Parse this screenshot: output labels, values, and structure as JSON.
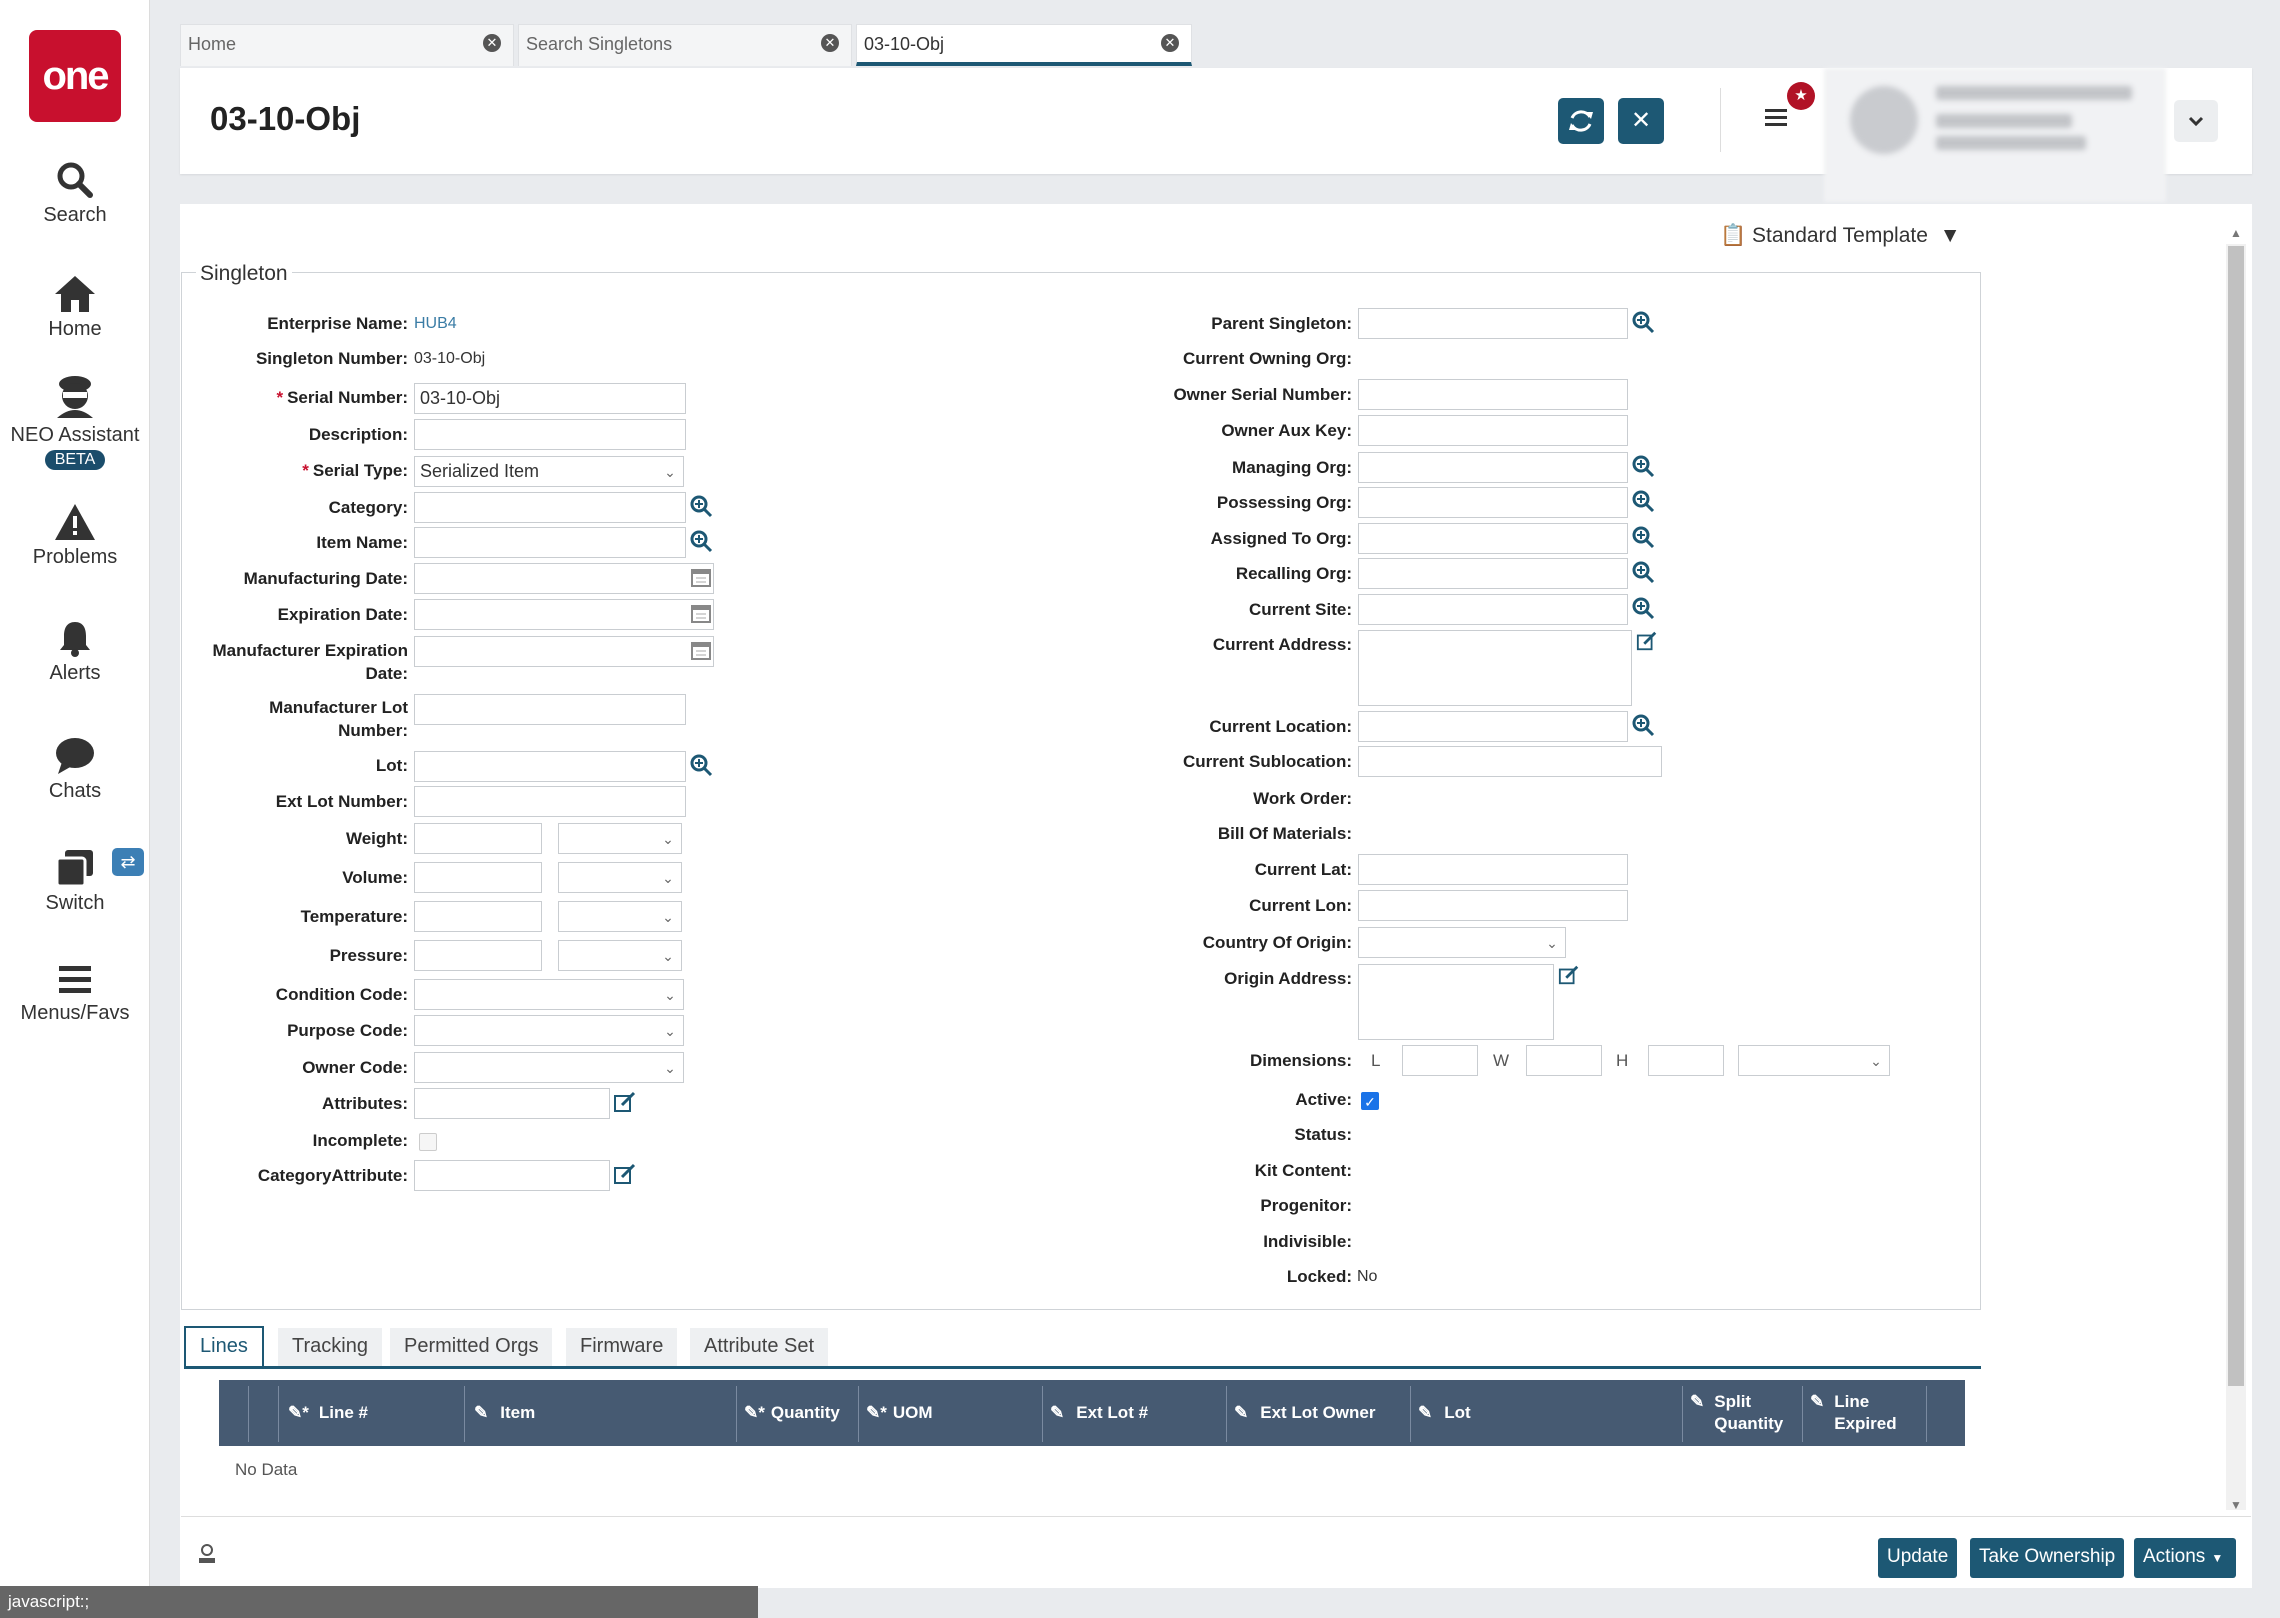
{
  "sidebar": {
    "logo": "one",
    "items": [
      {
        "label": "Search"
      },
      {
        "label": "Home"
      },
      {
        "label": "NEO Assistant",
        "badge": "BETA"
      },
      {
        "label": "Problems"
      },
      {
        "label": "Alerts"
      },
      {
        "label": "Chats"
      },
      {
        "label": "Switch"
      },
      {
        "label": "Menus/Favs"
      }
    ]
  },
  "tabs": [
    {
      "label": "Home"
    },
    {
      "label": "Search Singletons"
    },
    {
      "label": "03-10-Obj"
    }
  ],
  "header": {
    "title": "03-10-Obj"
  },
  "template": {
    "label": "Standard Template"
  },
  "section": {
    "title": "Singleton"
  },
  "left": {
    "enterprise_name": {
      "label": "Enterprise Name:",
      "value": "HUB4"
    },
    "singleton_number": {
      "label": "Singleton Number:",
      "value": "03-10-Obj"
    },
    "serial_number": {
      "label": "Serial Number:",
      "value": "03-10-Obj"
    },
    "description": {
      "label": "Description:"
    },
    "serial_type": {
      "label": "Serial Type:",
      "value": "Serialized Item"
    },
    "category": {
      "label": "Category:"
    },
    "item_name": {
      "label": "Item Name:"
    },
    "manufacturing_date": {
      "label": "Manufacturing Date:"
    },
    "expiration_date": {
      "label": "Expiration Date:"
    },
    "manufacturer_expiration_date": {
      "label1": "Manufacturer Expiration",
      "label2": "Date:"
    },
    "manufacturer_lot_number": {
      "label1": "Manufacturer Lot",
      "label2": "Number:"
    },
    "lot": {
      "label": "Lot:"
    },
    "ext_lot_number": {
      "label": "Ext Lot Number:"
    },
    "weight": {
      "label": "Weight:"
    },
    "volume": {
      "label": "Volume:"
    },
    "temperature": {
      "label": "Temperature:"
    },
    "pressure": {
      "label": "Pressure:"
    },
    "condition_code": {
      "label": "Condition Code:"
    },
    "purpose_code": {
      "label": "Purpose Code:"
    },
    "owner_code": {
      "label": "Owner Code:"
    },
    "attributes": {
      "label": "Attributes:"
    },
    "incomplete": {
      "label": "Incomplete:",
      "checked": false
    },
    "category_attribute": {
      "label": "CategoryAttribute:"
    }
  },
  "right": {
    "parent_singleton": {
      "label": "Parent Singleton:"
    },
    "current_owning_org": {
      "label": "Current Owning Org:"
    },
    "owner_serial_number": {
      "label": "Owner Serial Number:"
    },
    "owner_aux_key": {
      "label": "Owner Aux Key:"
    },
    "managing_org": {
      "label": "Managing Org:"
    },
    "possessing_org": {
      "label": "Possessing Org:"
    },
    "assigned_to_org": {
      "label": "Assigned To Org:"
    },
    "recalling_org": {
      "label": "Recalling Org:"
    },
    "current_site": {
      "label": "Current Site:"
    },
    "current_address": {
      "label": "Current Address:"
    },
    "current_location": {
      "label": "Current Location:"
    },
    "current_sublocation": {
      "label": "Current Sublocation:"
    },
    "work_order": {
      "label": "Work Order:"
    },
    "bill_of_materials": {
      "label": "Bill Of Materials:"
    },
    "current_lat": {
      "label": "Current Lat:"
    },
    "current_lon": {
      "label": "Current Lon:"
    },
    "country_of_origin": {
      "label": "Country Of Origin:"
    },
    "origin_address": {
      "label": "Origin Address:"
    },
    "dimensions": {
      "label": "Dimensions:",
      "l": "L",
      "w": "W",
      "h": "H"
    },
    "active": {
      "label": "Active:",
      "checked": true
    },
    "status": {
      "label": "Status:"
    },
    "kit_content": {
      "label": "Kit Content:"
    },
    "progenitor": {
      "label": "Progenitor:"
    },
    "indivisible": {
      "label": "Indivisible:"
    },
    "locked": {
      "label": "Locked:",
      "value": "No"
    }
  },
  "bottom_tabs": [
    {
      "label": "Lines"
    },
    {
      "label": "Tracking"
    },
    {
      "label": "Permitted Orgs"
    },
    {
      "label": "Firmware"
    },
    {
      "label": "Attribute Set"
    }
  ],
  "grid": {
    "columns": [
      {
        "label": "Line #"
      },
      {
        "label": "Item"
      },
      {
        "label": "Quantity"
      },
      {
        "label": "UOM"
      },
      {
        "label": "Ext Lot #"
      },
      {
        "label": "Ext Lot Owner"
      },
      {
        "label": "Lot"
      },
      {
        "label1": "Split",
        "label2": "Quantity"
      },
      {
        "label1": "Line",
        "label2": "Expired"
      }
    ],
    "empty_text": "No Data"
  },
  "footer": {
    "update": "Update",
    "take_ownership": "Take Ownership",
    "actions": "Actions"
  },
  "statusbar": {
    "text": "javascript:;"
  },
  "colors": {
    "brand": "#c8102e",
    "primary": "#1d5874",
    "grid_header": "#465a72",
    "link": "#3a7ca5"
  }
}
